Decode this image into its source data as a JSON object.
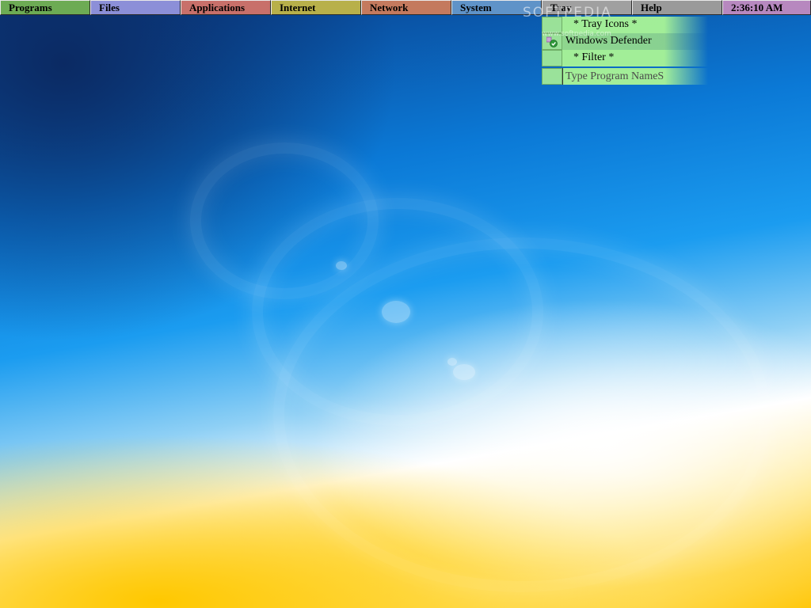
{
  "taskbar": {
    "items": [
      {
        "label": "Programs",
        "color": "#6dab54"
      },
      {
        "label": "Files",
        "color": "#8c8fd8"
      },
      {
        "label": "Applications",
        "color": "#c8706a"
      },
      {
        "label": "Internet",
        "color": "#b8b04a"
      },
      {
        "label": "Network",
        "color": "#c47a5e"
      },
      {
        "label": "System",
        "color": "#5f93c8"
      },
      {
        "label": "Tray",
        "color": "#a0a0a0"
      },
      {
        "label": "Help",
        "color": "#9a9a9a"
      }
    ],
    "clock": {
      "label": "2:36:10 AM",
      "color": "#b788bf"
    }
  },
  "tray_menu": {
    "header": "* Tray Icons *",
    "items": [
      {
        "label": "Windows Defender",
        "icon": "shield-check-icon"
      }
    ],
    "filter_label": "* Filter *",
    "filter_placeholder": "Type Program NameS"
  },
  "watermark": {
    "text": "SOFTPEDIA",
    "sub": "www.softpedia.com"
  }
}
